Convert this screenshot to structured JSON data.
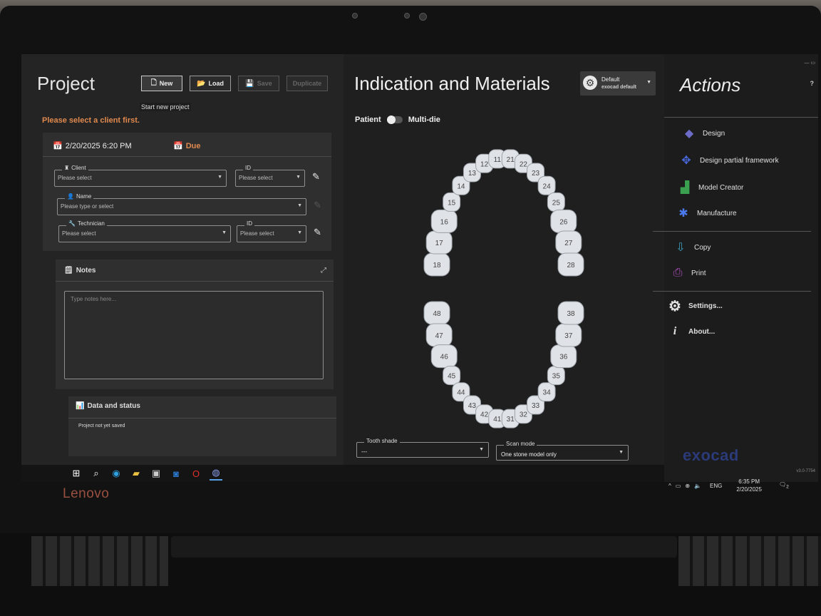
{
  "hardware": {
    "brand": "Lenovo"
  },
  "project": {
    "title": "Project",
    "buttons": {
      "new": "New",
      "load": "Load",
      "save": "Save",
      "duplicate": "Duplicate"
    },
    "tooltip": "Start new project",
    "warning": "Please select a client first.",
    "date": "2/20/2025 6:20 PM",
    "due": "Due",
    "client": {
      "label": "Client",
      "placeholder": "Please select",
      "id_label": "ID",
      "id_placeholder": "Please select"
    },
    "name": {
      "label": "Name",
      "placeholder": "Please type or select"
    },
    "technician": {
      "label": "Technician",
      "placeholder": "Please select",
      "id_label": "ID",
      "id_placeholder": "Please select"
    },
    "notes": {
      "title": "Notes",
      "placeholder": "Type notes here..."
    },
    "data_status": {
      "title": "Data and status",
      "status": "Project not yet saved"
    }
  },
  "indication": {
    "title": "Indication and Materials",
    "default_box": {
      "line1": "Default",
      "line2": "exocad default"
    },
    "toggle": {
      "left": "Patient",
      "right": "Multi-die"
    },
    "upper_teeth": [
      "18",
      "17",
      "16",
      "15",
      "14",
      "13",
      "12",
      "11",
      "21",
      "22",
      "23",
      "24",
      "25",
      "26",
      "27",
      "28"
    ],
    "lower_teeth": [
      "48",
      "47",
      "46",
      "45",
      "44",
      "43",
      "42",
      "41",
      "31",
      "32",
      "33",
      "34",
      "35",
      "36",
      "37",
      "38"
    ],
    "tooth_shade": {
      "label": "Tooth shade",
      "value": "---"
    },
    "scan_mode": {
      "label": "Scan mode",
      "value": "One stone model only"
    }
  },
  "actions": {
    "title": "Actions",
    "help": "?",
    "items": [
      {
        "label": "Design",
        "icon": "tooth-design-icon"
      },
      {
        "label": "Design partial framework",
        "icon": "partial-framework-icon"
      },
      {
        "label": "Model Creator",
        "icon": "model-creator-icon"
      },
      {
        "label": "Manufacture",
        "icon": "manufacture-icon"
      },
      {
        "label": "Copy",
        "icon": "copy-icon"
      },
      {
        "label": "Print",
        "icon": "printer-icon"
      },
      {
        "label": "Settings...",
        "icon": "gear-icon"
      },
      {
        "label": "About...",
        "icon": "info-icon"
      }
    ],
    "logo": "exocad",
    "version": "v3.0-7754"
  },
  "taskbar": {
    "language": "ENG",
    "time": "6:35 PM",
    "date": "2/20/2025",
    "notifications": "2"
  }
}
